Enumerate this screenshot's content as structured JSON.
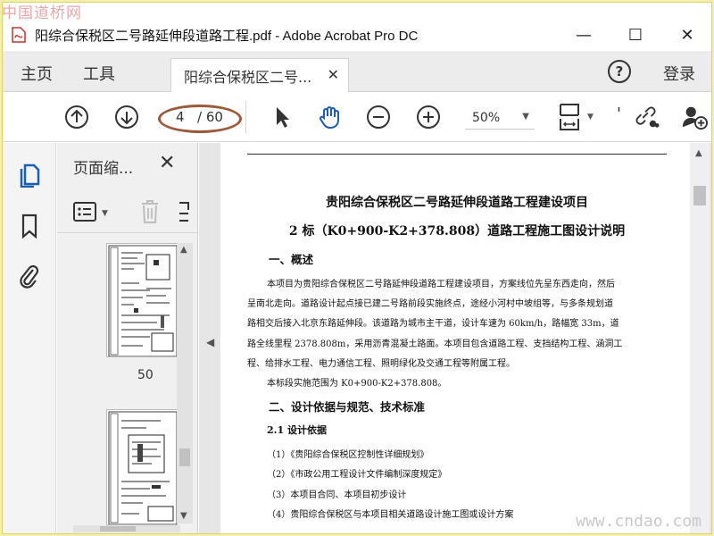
{
  "watermarks": {
    "top": "中国道桥网",
    "bottom": "www.cndao.com"
  },
  "window": {
    "title": "阳综合保税区二号路延伸段道路工程.pdf - Adobe Acrobat Pro DC",
    "minimize": "—",
    "maximize": "☐",
    "close": "✕"
  },
  "tabs": {
    "home": "主页",
    "tools": "工具",
    "document": "阳综合保税区二号...",
    "document_close": "✕",
    "help": "?",
    "login": "登录"
  },
  "toolbar": {
    "current_page": "4",
    "total_pages": "/ 60",
    "zoom": "50%",
    "zoom_caret": "▼",
    "partial_icon": "'"
  },
  "panel": {
    "title": "页面缩...",
    "close": "✕",
    "thumbnail_page_label": "50"
  },
  "document": {
    "title_line1": "贵阳综合保税区二号路延伸段道路工程建设项目",
    "title_line2": "2 标（K0+900-K2+378.808）道路工程施工图设计说明",
    "section1": "一、概述",
    "para1": [
      "本项目为贵阳综合保税区二号路延伸段道路工程建设项目，方案线位先呈东西走向，然后",
      "呈南北走向。道路设计起点接已建二号路前段实施终点，途经小河村中坡组等，与多条规划道",
      "路相交后接入北京东路延伸段。该道路为城市主干道，设计车速为 60km/h，路幅宽 33m，道",
      "路全线里程 2378.808m，采用沥青混凝土路面。本项目包含道路工程、支挡结构工程、涵洞工",
      "程、给排水工程、电力通信工程、照明绿化及交通工程等附属工程。"
    ],
    "para2": "本标段实施范围为 K0+900-K2+378.808。",
    "section2": "二、设计依据与规范、技术标准",
    "subsection21": "2.1  设计依据",
    "list": [
      "（1）《贵阳综合保税区控制性详细规划》",
      "（2）《市政公用工程设计文件编制深度规定》",
      "（3）本项目合同、本项目初步设计",
      "（4）贵阳综合保税区与本项目相关道路设计施工图或设计方案"
    ]
  },
  "colors": {
    "accent": "#1a5fb4",
    "annotation": "#9c5a3c"
  }
}
